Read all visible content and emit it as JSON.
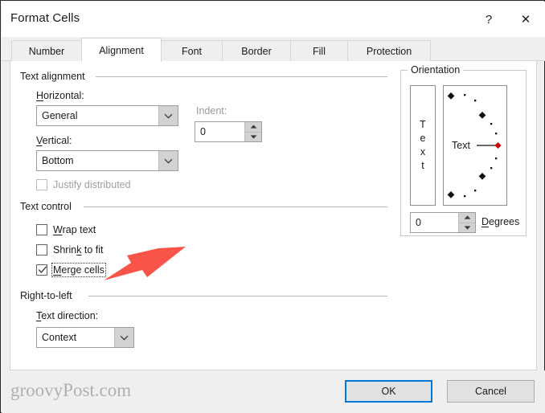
{
  "window": {
    "title": "Format Cells",
    "help_glyph": "?",
    "close_glyph": "✕"
  },
  "tabs": [
    {
      "label": "Number",
      "active": false
    },
    {
      "label": "Alignment",
      "active": true
    },
    {
      "label": "Font",
      "active": false
    },
    {
      "label": "Border",
      "active": false
    },
    {
      "label": "Fill",
      "active": false
    },
    {
      "label": "Protection",
      "active": false
    }
  ],
  "text_alignment": {
    "group_label": "Text alignment",
    "horizontal": {
      "label": "Horizontal:",
      "accel": "H",
      "value": "General"
    },
    "vertical": {
      "label": "Vertical:",
      "accel": "V",
      "value": "Bottom"
    },
    "indent": {
      "label": "Indent:",
      "value": "0",
      "disabled": true
    },
    "justify_distributed": {
      "label": "Justify distributed",
      "checked": false,
      "disabled": true
    }
  },
  "text_control": {
    "group_label": "Text control",
    "items": [
      {
        "label": "Wrap text",
        "accel": "W",
        "checked": false,
        "focused": false
      },
      {
        "label": "Shrink to fit",
        "accel": "k",
        "checked": false,
        "focused": false
      },
      {
        "label": "Merge cells",
        "accel": "M",
        "checked": true,
        "focused": true
      }
    ]
  },
  "right_to_left": {
    "group_label": "Right-to-left",
    "text_direction": {
      "label": "Text direction:",
      "accel": "T",
      "value": "Context"
    }
  },
  "orientation": {
    "group_label": "Orientation",
    "vertical_preview_letters": [
      "T",
      "e",
      "x",
      "t"
    ],
    "dial_text": "Text",
    "degrees": {
      "value": "0",
      "label": "Degrees",
      "accel": "D"
    },
    "marker_color": "#cc0000"
  },
  "footer": {
    "watermark": "groovyPost.com",
    "ok_label": "OK",
    "cancel_label": "Cancel"
  },
  "annotation": {
    "arrow_color": "#f9544a",
    "points_at": "Merge cells"
  }
}
